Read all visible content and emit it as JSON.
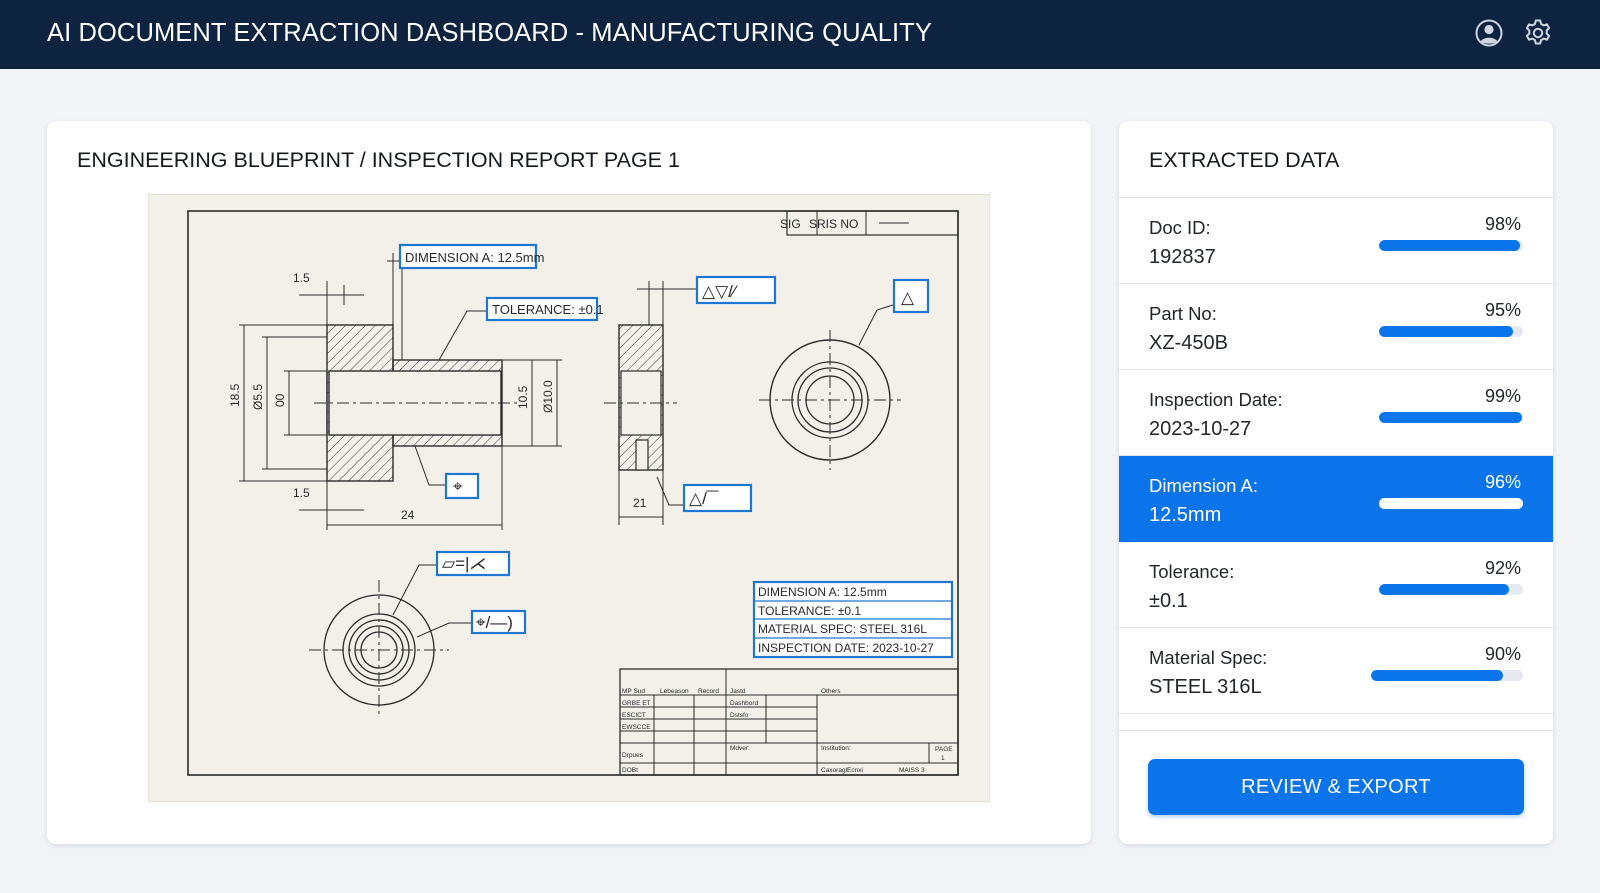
{
  "header": {
    "title": "AI DOCUMENT EXTRACTION DASHBOARD - MANUFACTURING QUALITY",
    "icons": [
      "user-icon",
      "settings-gear-icon"
    ],
    "background_color": "#0d2340"
  },
  "document_panel": {
    "title": "ENGINEERING BLUEPRINT / INSPECTION REPORT PAGE 1",
    "blueprint": {
      "title_block_labels": [
        "SIG",
        "SRIS NO"
      ],
      "annotations": {
        "dimension_a": "DIMENSION A: 12.5mm",
        "tolerance": "TOLERANCE: ±0.1"
      },
      "summary_box": [
        "DIMENSION A: 12.5mm",
        "TOLERANCE: ±0.1",
        "MATERIAL SPEC: STEEL 316L",
        "INSPECTION DATE: 2023-10-27"
      ],
      "dimension_labels": {
        "top_step": "1.5",
        "bottom_step": "1.5",
        "length": "24",
        "side_width": "21",
        "h1": "18.5",
        "h2": "Ø5.5",
        "h3": "00",
        "h4": "10.5",
        "h5": "Ø10.0"
      },
      "gdt_symbols": {
        "top_frame": "△▽/⁄",
        "warning_frame": "△",
        "position": "⌖",
        "profile": "△/‾‾",
        "flatness": "▱=|⋌",
        "position_2": "⌖/—)"
      },
      "title_block": {
        "r1": [
          "MP Sud",
          "Lebeason",
          "Record",
          "Jastd",
          "Others"
        ],
        "r2": [
          "GRBE ET",
          "Dashbord"
        ],
        "r3": [
          "ESCICT",
          "Dstsfo"
        ],
        "r4": [
          "EWSCCE"
        ],
        "r5": [
          "Drpues",
          "Mdver:",
          "Institution:",
          "PAGE",
          "1"
        ],
        "r6": [
          "DOBt",
          "CaxoraglEcnxi",
          "MAISS 3"
        ]
      }
    }
  },
  "extracted_panel": {
    "title": "EXTRACTED DATA",
    "fields": [
      {
        "label": "Doc ID:",
        "value": "192837",
        "confidence": "98%",
        "fraction": 0.98,
        "active": false
      },
      {
        "label": "Part No:",
        "value": "XZ-450B",
        "confidence": "95%",
        "fraction": 0.93,
        "active": false
      },
      {
        "label": "Inspection Date:",
        "value": "2023-10-27",
        "confidence": "99%",
        "fraction": 0.99,
        "active": false
      },
      {
        "label": "Dimension A:",
        "value": "12.5mm",
        "confidence": "96%",
        "fraction": 0.96,
        "active": true
      },
      {
        "label": "Tolerance:",
        "value": "±0.1",
        "confidence": "92%",
        "fraction": 0.9,
        "active": false
      },
      {
        "label": "Material Spec:",
        "value": "STEEL 316L",
        "confidence": "90%",
        "fraction": 0.87,
        "active": false
      }
    ],
    "export_button": "REVIEW & EXPORT"
  },
  "colors": {
    "accent": "#0b74ea",
    "page_background": "#f2f4f8",
    "blueprint_paper": "#f3f0ea",
    "annotation_box": "#1f76d0"
  }
}
